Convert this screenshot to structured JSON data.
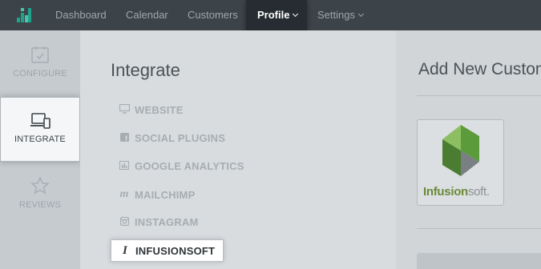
{
  "topnav": {
    "items": [
      {
        "label": "Dashboard",
        "active": false
      },
      {
        "label": "Calendar",
        "active": false
      },
      {
        "label": "Customers",
        "active": false
      },
      {
        "label": "Profile",
        "active": true
      },
      {
        "label": "Settings",
        "active": false
      }
    ]
  },
  "rail": {
    "items": [
      {
        "label": "CONFIGURE",
        "icon": "calendar-check-icon"
      },
      {
        "label": "INTEGRATE",
        "icon": "devices-icon",
        "active": true
      },
      {
        "label": "REVIEWS",
        "icon": "star-icon"
      }
    ]
  },
  "panel": {
    "title": "Integrate",
    "items": [
      {
        "label": "WEBSITE",
        "icon": "monitor-icon"
      },
      {
        "label": "SOCIAL PLUGINS",
        "icon": "facebook-icon"
      },
      {
        "label": "GOOGLE ANALYTICS",
        "icon": "bar-chart-icon"
      },
      {
        "label": "MAILCHIMP",
        "icon": "mailchimp-icon"
      },
      {
        "label": "INSTAGRAM",
        "icon": "instagram-icon"
      },
      {
        "label": "INFUSIONSOFT",
        "icon": "infusionsoft-icon",
        "active": true
      }
    ]
  },
  "right": {
    "title": "Add New Customer",
    "logo_text_primary": "Infusion",
    "logo_text_secondary": "soft."
  },
  "colors": {
    "nav_bg": "#3c4349",
    "nav_active_bg": "#262c31",
    "brand_green": "#6aa84f",
    "brand_teal": "#1fa38a"
  }
}
